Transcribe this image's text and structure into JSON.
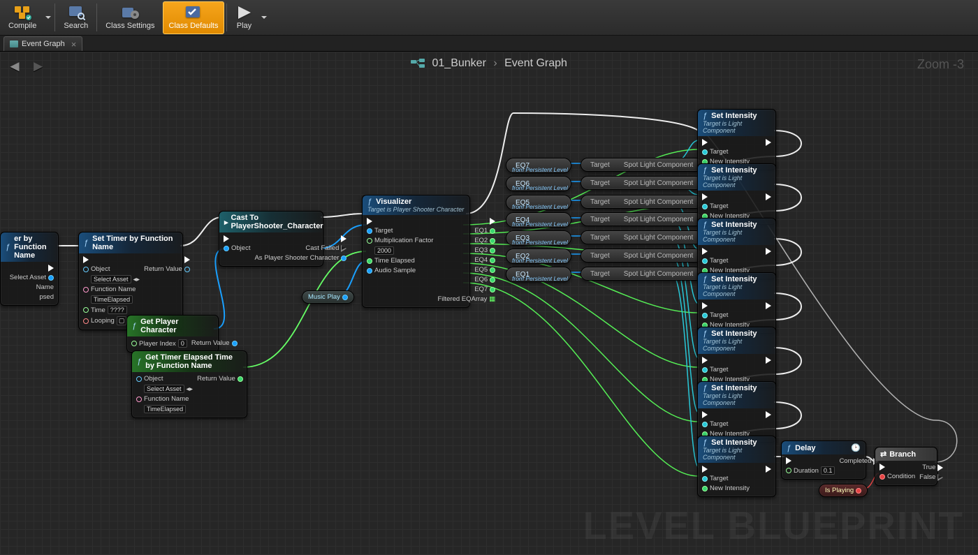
{
  "toolbar": {
    "compile": "Compile",
    "search": "Search",
    "class_settings": "Class Settings",
    "class_defaults": "Class Defaults",
    "play": "Play"
  },
  "tab": {
    "label": "Event Graph"
  },
  "breadcrumb": {
    "level": "01_Bunker",
    "graph": "Event Graph"
  },
  "zoom": "Zoom -3",
  "watermark": "LEVEL BLUEPRINT",
  "nodes": {
    "timerLeft": {
      "title": "er by Function Name",
      "obj": "Select Asset",
      "name": "Name",
      "elapsed": "psed"
    },
    "setTimer": {
      "title": "Set Timer by Function Name",
      "obj_lbl": "Object",
      "obj_val": "Select Asset",
      "fn_lbl": "Function Name",
      "fn_val": "TimeElapsed",
      "time_lbl": "Time",
      "time_val": "????",
      "loop_lbl": "Looping",
      "ret": "Return Value"
    },
    "cast": {
      "title": "Cast To PlayerShooter_Character",
      "obj": "Object",
      "fail": "Cast Failed",
      "as": "As Player Shooter Character"
    },
    "getChar": {
      "title": "Get Player Character",
      "idx": "Player Index",
      "idx_val": "0",
      "ret": "Return Value"
    },
    "getElapsed": {
      "title": "Get Timer Elapsed Time by Function Name",
      "obj_lbl": "Object",
      "obj_val": "Select Asset",
      "fn_lbl": "Function Name",
      "fn_val": "TimeElapsed",
      "ret": "Return Value"
    },
    "music": {
      "label": "Music Play"
    },
    "visual": {
      "title": "Visualizer",
      "sub": "Target is Player Shooter Character",
      "tgt": "Target",
      "mul": "Multiplication Factor",
      "mul_val": "2000",
      "time": "Time Elapsed",
      "audio": "Audio Sample",
      "eq": [
        "EQ1",
        "EQ2",
        "EQ3",
        "EQ4",
        "EQ5",
        "EQ6",
        "EQ7"
      ],
      "arr": "Filtered EQArray"
    },
    "eq_from": "from Persistent Level",
    "spot_target": "Target",
    "spot_comp": "Spot Light Component",
    "setInt": {
      "title": "Set Intensity",
      "sub": "Target is Light Component",
      "tgt": "Target",
      "new": "New Intensity"
    },
    "delay": {
      "title": "Delay",
      "dur": "Duration",
      "dur_val": "0.1",
      "comp": "Completed"
    },
    "branch": {
      "title": "Branch",
      "cond": "Condition",
      "t": "True",
      "f": "False"
    },
    "playing": {
      "label": "Is Playing"
    }
  },
  "eq_refs": [
    "EQ7",
    "EQ6",
    "EQ5",
    "EQ4",
    "EQ3",
    "EQ2",
    "EQ1"
  ]
}
